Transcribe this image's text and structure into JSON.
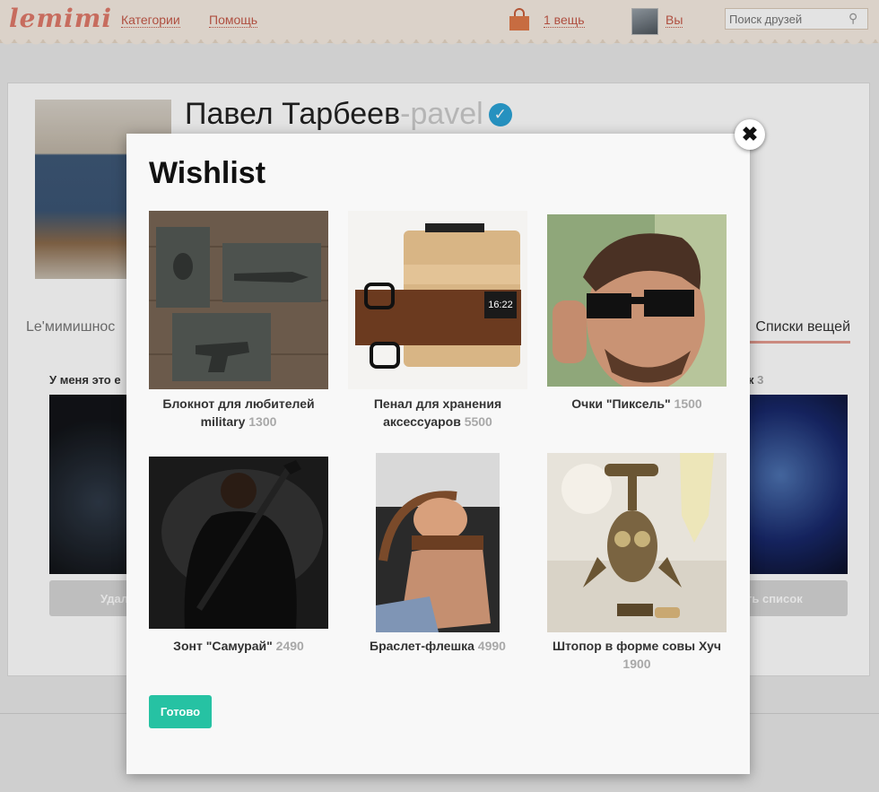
{
  "header": {
    "logo": "lemimi",
    "nav": [
      "Категории",
      "Помощь"
    ],
    "cart_label": "1 вещь",
    "user_label": "Вы",
    "search_placeholder": "Поиск друзей"
  },
  "profile": {
    "name": "Павел Тарбеев",
    "nick": "-pavel",
    "tab_left": "Le'мимишнос",
    "tab_right": "Списки вещей",
    "col_left_title": "У меня это е",
    "col_right_title": "ок",
    "col_right_count": "3",
    "btn_left": "Удали",
    "btn_right": "ть список"
  },
  "modal": {
    "title": "Wishlist",
    "close_label": "✖",
    "done_label": "Готово",
    "items": [
      {
        "name": "Блокнот для любителей military",
        "price": "1300"
      },
      {
        "name": "Пенал для хранения аксессуаров",
        "price": "5500"
      },
      {
        "name": "Очки \"Пиксель\"",
        "price": "1500"
      },
      {
        "name": "Зонт \"Самурай\"",
        "price": "2490"
      },
      {
        "name": "Браслет-флешка",
        "price": "4990"
      },
      {
        "name": "Штопор в форме совы Хуч",
        "price": "1900"
      }
    ]
  },
  "colors": {
    "accent_done": "#26c2a3",
    "brand": "#e07a6a",
    "verified": "#2ba3d7"
  }
}
